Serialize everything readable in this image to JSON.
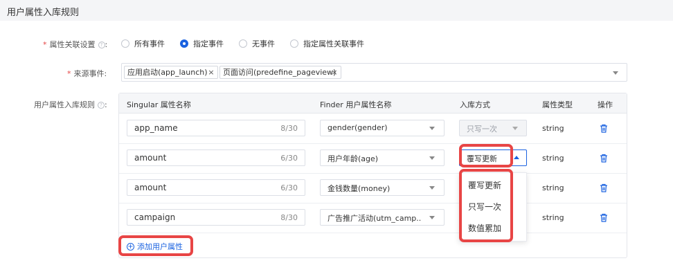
{
  "header": {
    "title": "用户属性入库规则"
  },
  "form": {
    "relation_label": "属性关联设置",
    "relation_help": "?",
    "relation_colon": ":",
    "relation_options": [
      "所有事件",
      "指定事件",
      "无事件",
      "指定属性关联事件"
    ],
    "relation_selected": "指定事件",
    "source_label": "来源事件:",
    "source_tags": [
      "应用启动(app_launch)",
      "页面访问(predefine_pageview)"
    ],
    "tag_close": "×",
    "rules_label": "用户属性入库规则",
    "rules_colon": ":"
  },
  "table": {
    "headers": [
      "Singular 属性名称",
      "Finder 用户属性名称",
      "入库方式",
      "属性类型",
      "操作"
    ],
    "rows": [
      {
        "singular": "app_name",
        "count": "8/30",
        "finder": "gender(gender)",
        "mode": "只写一次",
        "type": "string"
      },
      {
        "singular": "amount",
        "count": "6/30",
        "finder": "用户年龄(age)",
        "mode": "覆写更新",
        "type": "string"
      },
      {
        "singular": "amount",
        "count": "6/30",
        "finder": "金钱数量(money)",
        "mode": "",
        "type": "string"
      },
      {
        "singular": "campaign",
        "count": "8/30",
        "finder": "广告推广活动(utm_camp...",
        "mode": "",
        "type": "string"
      }
    ]
  },
  "dropdown": {
    "options": [
      "覆写更新",
      "只写一次",
      "数值累加"
    ]
  },
  "add_button": {
    "label": "添加用户属性",
    "icon": "plus-circle-icon"
  },
  "colors": {
    "accent": "#1a62e0",
    "highlight": "#e84545",
    "required": "#e54545"
  }
}
